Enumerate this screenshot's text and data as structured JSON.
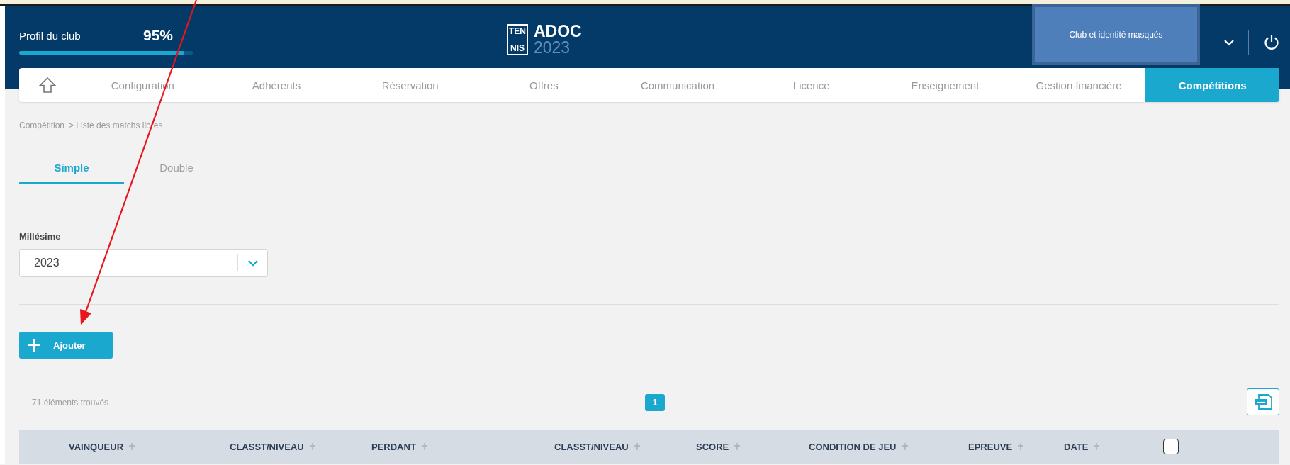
{
  "header": {
    "profile": {
      "label": "Profil du club",
      "percent": "95%",
      "level": 0.95
    },
    "logo": {
      "badge_top": "TEN",
      "badge_bottom": "NIS",
      "title": "ADOC",
      "year": "2023"
    },
    "masked_notice": "Club et identité masqués"
  },
  "nav": [
    {
      "label": "Configuration",
      "selected": false
    },
    {
      "label": "Adhérents",
      "selected": false
    },
    {
      "label": "Réservation",
      "selected": false
    },
    {
      "label": "Offres",
      "selected": false
    },
    {
      "label": "Communication",
      "selected": false
    },
    {
      "label": "Licence",
      "selected": false
    },
    {
      "label": "Enseignement",
      "selected": false
    },
    {
      "label": "Gestion financière",
      "selected": false
    },
    {
      "label": "Compétitions",
      "selected": true
    }
  ],
  "breadcrumb": [
    "Compétition",
    "> Liste des matchs libres"
  ],
  "tabs": [
    {
      "label": "Simple",
      "selected": true
    },
    {
      "label": "Double",
      "selected": false
    }
  ],
  "millesime": {
    "label": "Millésime",
    "value": "2023"
  },
  "add_button": "Ajouter",
  "results": {
    "count": "71 éléments trouvés",
    "pages": [
      {
        "label": "1",
        "selected": true
      }
    ]
  },
  "table": {
    "columns": [
      "VAINQUEUR",
      "CLASST/NIVEAU",
      "PERDANT",
      "CLASST/NIVEAU",
      "SCORE",
      "CONDITION DE JEU",
      "EPREUVE",
      "DATE"
    ],
    "select_all_checked": false
  },
  "annotation": {
    "kind": "arrow"
  }
}
